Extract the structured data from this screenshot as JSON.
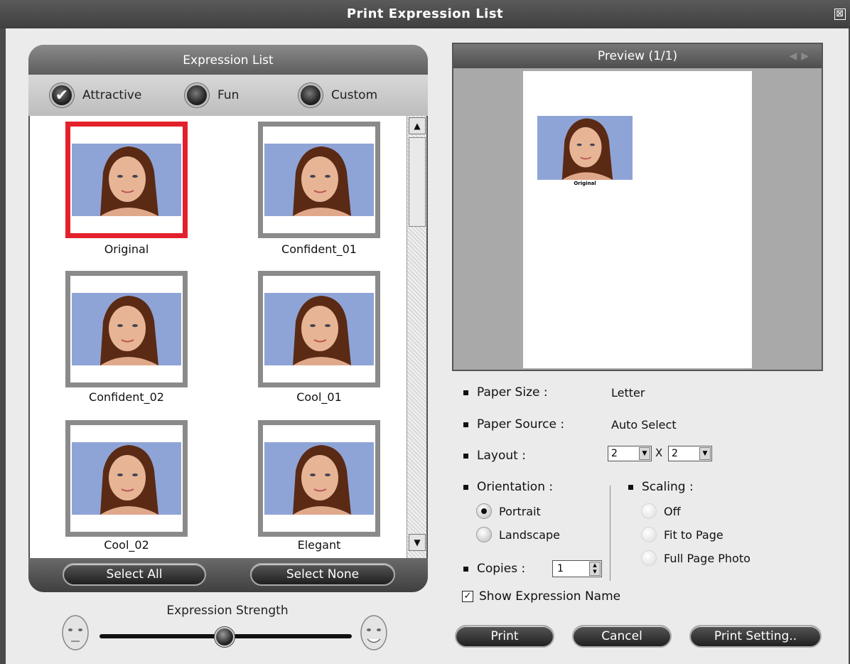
{
  "window": {
    "title": "Print Expression List",
    "close_glyph": "⊠"
  },
  "expression_list": {
    "header": "Expression List",
    "tabs": [
      {
        "label": "Attractive",
        "checked": true
      },
      {
        "label": "Fun",
        "checked": false
      },
      {
        "label": "Custom",
        "checked": false
      }
    ],
    "items": [
      {
        "label": "Original",
        "selected": true
      },
      {
        "label": "Confident_01",
        "selected": false
      },
      {
        "label": "Confident_02",
        "selected": false
      },
      {
        "label": "Cool_01",
        "selected": false
      },
      {
        "label": "Cool_02",
        "selected": false
      },
      {
        "label": "Elegant",
        "selected": false
      }
    ],
    "select_all_label": "Select All",
    "select_none_label": "Select None"
  },
  "expression_strength": {
    "label": "Expression Strength",
    "value_fraction": 0.5
  },
  "preview": {
    "title": "Preview (1/1)",
    "thumb_label": "Original"
  },
  "settings": {
    "paper_size_label": "Paper Size :",
    "paper_size_value": "Letter",
    "paper_source_label": "Paper Source :",
    "paper_source_value": "Auto Select",
    "layout_label": "Layout :",
    "layout_cols": "2",
    "layout_x": "X",
    "layout_rows": "2",
    "orientation_label": "Orientation :",
    "orientation_options": [
      {
        "label": "Portrait",
        "selected": true
      },
      {
        "label": "Landscape",
        "selected": false
      }
    ],
    "scaling_label": "Scaling :",
    "scaling_options": [
      {
        "label": "Off",
        "selected": false
      },
      {
        "label": "Fit to Page",
        "selected": false
      },
      {
        "label": "Full Page Photo",
        "selected": false
      }
    ],
    "copies_label": "Copies :",
    "copies_value": "1",
    "show_name_label": "Show Expression Name",
    "show_name_checked": true
  },
  "buttons": {
    "print": "Print",
    "cancel": "Cancel",
    "print_setting": "Print Setting.."
  },
  "colors": {
    "selected_border": "#e3212b",
    "panel_dark": "#525252"
  }
}
